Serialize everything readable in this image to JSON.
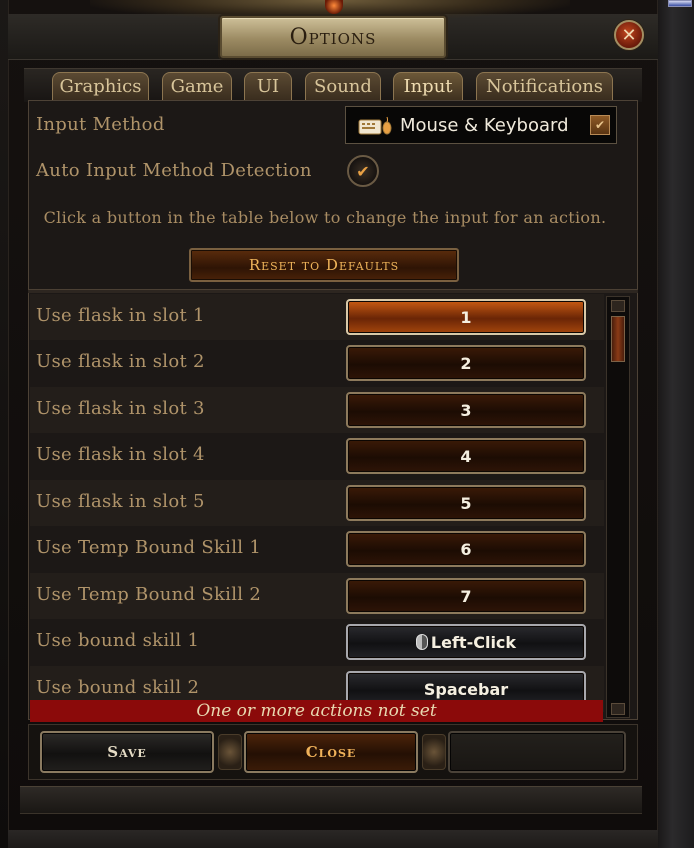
{
  "window": {
    "title": "Options"
  },
  "tabs": [
    {
      "label": "Graphics"
    },
    {
      "label": "Game"
    },
    {
      "label": "UI"
    },
    {
      "label": "Sound"
    },
    {
      "label": "Input",
      "active": true
    },
    {
      "label": "Notifications"
    }
  ],
  "input": {
    "method_label": "Input Method",
    "method_value": "Mouse & Keyboard",
    "auto_detect_label": "Auto Input Method Detection",
    "auto_detect_checked": true,
    "hint": "Click a button in the table below to change the input for an action.",
    "reset_label": "Reset to Defaults"
  },
  "bindings": [
    {
      "action": "Use flask in slot 1",
      "key": "1"
    },
    {
      "action": "Use flask in slot 2",
      "key": "2"
    },
    {
      "action": "Use flask in slot 3",
      "key": "3"
    },
    {
      "action": "Use flask in slot 4",
      "key": "4"
    },
    {
      "action": "Use flask in slot 5",
      "key": "5"
    },
    {
      "action": "Use Temp Bound Skill 1",
      "key": "6"
    },
    {
      "action": "Use Temp Bound Skill 2",
      "key": "7"
    },
    {
      "action": "Use bound skill 1",
      "key": "Left-Click"
    },
    {
      "action": "Use bound skill 2",
      "key": "Spacebar"
    }
  ],
  "warning": "One or more actions not set",
  "footer": {
    "save_label": "Save",
    "close_label": "Close"
  },
  "colors": {
    "accent": "#c85a12",
    "label": "#b0946a",
    "warning_bg": "#8b0a0a"
  }
}
